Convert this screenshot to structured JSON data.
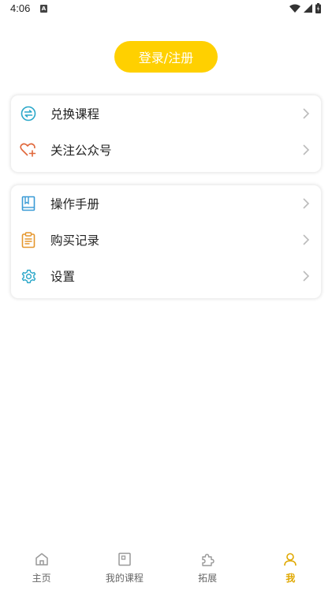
{
  "status_bar": {
    "time": "4:06",
    "notification_icon": "A"
  },
  "login_button": {
    "label": "登录/注册"
  },
  "menu_group_1": [
    {
      "label": "兑换课程",
      "icon": "exchange-icon"
    },
    {
      "label": "关注公众号",
      "icon": "heart-plus-icon"
    }
  ],
  "menu_group_2": [
    {
      "label": "操作手册",
      "icon": "book-icon"
    },
    {
      "label": "购买记录",
      "icon": "clipboard-icon"
    },
    {
      "label": "设置",
      "icon": "gear-icon"
    }
  ],
  "bottom_nav": [
    {
      "label": "主页",
      "icon": "home-icon"
    },
    {
      "label": "我的课程",
      "icon": "course-icon"
    },
    {
      "label": "拓展",
      "icon": "puzzle-icon"
    },
    {
      "label": "我",
      "icon": "person-icon",
      "active": true
    }
  ],
  "colors": {
    "accent": "#ffd000",
    "active_tab": "#e0a800",
    "icon_teal": "#2aa7c9",
    "icon_orange": "#e58a2c"
  }
}
